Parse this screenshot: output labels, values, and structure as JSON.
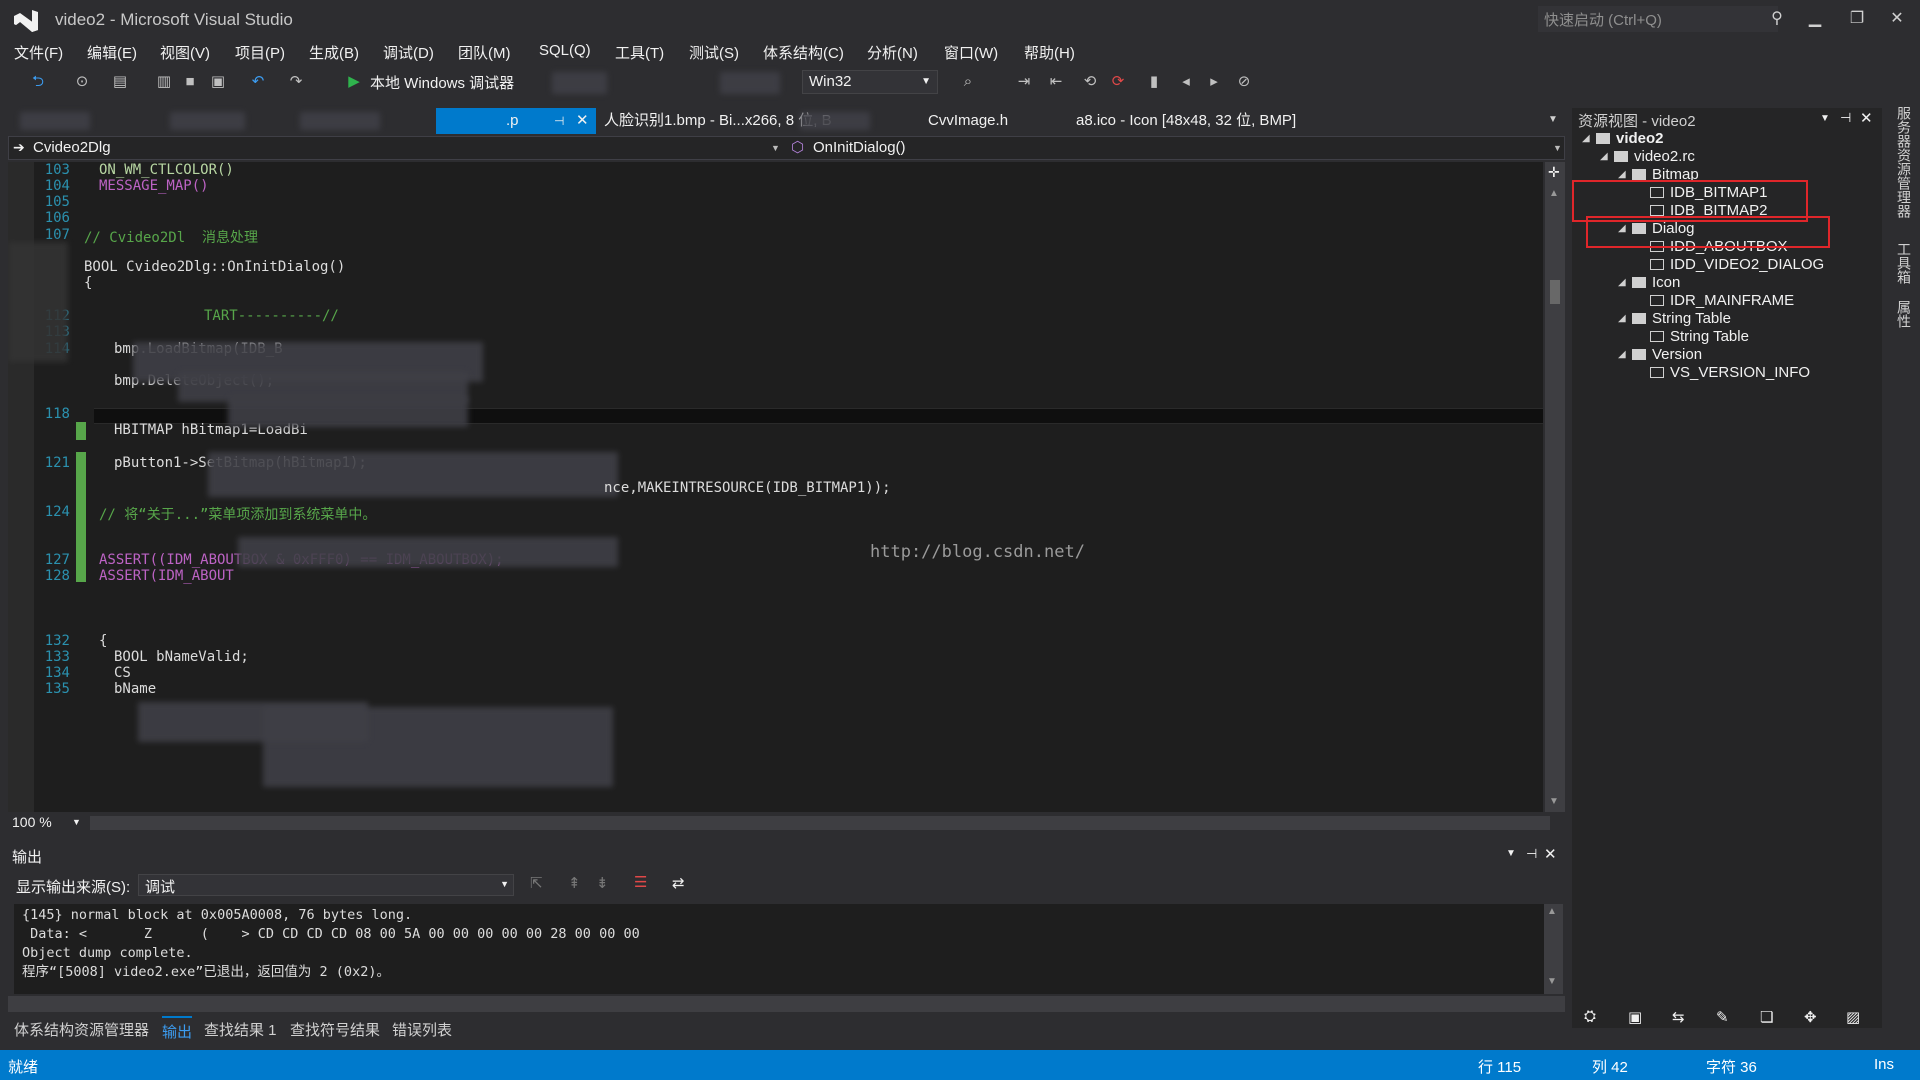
{
  "window": {
    "title": "video2 - Microsoft Visual Studio",
    "quick_launch": "快速启动 (Ctrl+Q)"
  },
  "menu": [
    "文件(F)",
    "编辑(E)",
    "视图(V)",
    "项目(P)",
    "生成(B)",
    "调试(D)",
    "团队(M)",
    "SQL(Q)",
    "工具(T)",
    "测试(S)",
    "体系结构(C)",
    "分析(N)",
    "窗口(W)",
    "帮助(H)"
  ],
  "toolbar": {
    "debug_target": "本地 Windows 调试器",
    "platform": "Win32"
  },
  "tabs": [
    {
      "label": ".p"
    },
    {
      "label": "人脸识别1.bmp - Bi...x266, 8 位, B"
    },
    {
      "label": "CvvImage.h"
    },
    {
      "label": "a8.ico - Icon [48x48, 32 位, BMP]"
    }
  ],
  "nav": {
    "class": "Cvideo2Dlg",
    "method": "OnInitDialog()"
  },
  "code": [
    {
      "ln": "103",
      "text": "ON_WM_CTLCOLOR()",
      "indent": 1,
      "color": "#b8d7a3"
    },
    {
      "ln": "104",
      "text": "MESSAGE_MAP()",
      "indent": 1,
      "color": "#bd63c5"
    },
    {
      "ln": "105",
      "text": "",
      "indent": 0,
      "color": "#dcdcdc"
    },
    {
      "ln": "106",
      "text": "",
      "indent": 0,
      "color": "#dcdcdc"
    },
    {
      "ln": "107",
      "text": "// Cvideo2Dl  消息处理",
      "indent": 0,
      "color": "#57a64a"
    },
    {
      "ln": "",
      "text": "BOOL Cvideo2Dlg::OnInitDialog()",
      "indent": 0,
      "color": "#dcdcdc"
    },
    {
      "ln": "",
      "text": "{",
      "indent": 0,
      "color": "#dcdcdc"
    },
    {
      "ln": "112",
      "text": "TART----------//",
      "indent": 8,
      "color": "#57a64a"
    },
    {
      "ln": "113",
      "text": "",
      "indent": 0,
      "color": "#dcdcdc"
    },
    {
      "ln": "114",
      "text": "bmp.LoadBitmap(IDB_B",
      "indent": 2,
      "color": "#dcdcdc"
    },
    {
      "ln": "",
      "text": "bmp.DeleteObject();",
      "indent": 2,
      "color": "#dcdcdc"
    },
    {
      "ln": "118",
      "text": "",
      "indent": 0,
      "color": "#dcdcdc"
    },
    {
      "ln": "",
      "text": "HBITMAP hBitmap1=LoadBi",
      "indent": 2,
      "color": "#dcdcdc"
    },
    {
      "ln": "121",
      "text": "pButton1->SetBitmap(hBitmap1);",
      "indent": 2,
      "color": "#dcdcdc"
    },
    {
      "ln": "124",
      "text": "// 将“关于...”菜单项添加到系统菜单中。",
      "indent": 1,
      "color": "#57a64a"
    },
    {
      "ln": "127",
      "text": "ASSERT((IDM_ABOUTBOX & 0xFFF0) == IDM_ABOUTBOX);",
      "indent": 1,
      "color": "#bd63c5"
    },
    {
      "ln": "128",
      "text": "ASSERT(IDM_ABOUT",
      "indent": 1,
      "color": "#bd63c5"
    },
    {
      "ln": "132",
      "text": "{",
      "indent": 1,
      "color": "#dcdcdc"
    },
    {
      "ln": "133",
      "text": "BOOL bNameValid;",
      "indent": 2,
      "color": "#dcdcdc"
    },
    {
      "ln": "134",
      "text": "CS",
      "indent": 2,
      "color": "#dcdcdc"
    },
    {
      "ln": "135",
      "text": "bName",
      "indent": 2,
      "color": "#dcdcdc"
    }
  ],
  "code_extra": {
    "line_118_tail": "nce,MAKEINTRESOURCE(IDB_BITMAP1));",
    "watermark": "http://blog.csdn.net/"
  },
  "editor": {
    "zoom": "100 %"
  },
  "output": {
    "title": "输出",
    "source_label": "显示输出来源(S):",
    "source_value": "调试",
    "lines": [
      "{145} normal block at 0x005A0008, 76 bytes long.",
      " Data: <       Z      (    > CD CD CD CD 08 00 5A 00 00 00 00 00 28 00 00 00",
      "Object dump complete.",
      "程序“[5008] video2.exe”已退出，返回值为 2 (0x2)。"
    ]
  },
  "bottom_tabs": [
    "体系结构资源管理器",
    "输出",
    "查找结果 1",
    "查找符号结果",
    "错误列表"
  ],
  "resource_view": {
    "title": "资源视图 - video2",
    "tree": [
      {
        "label": "video2",
        "depth": 0,
        "bold": true
      },
      {
        "label": "video2.rc",
        "depth": 1
      },
      {
        "label": "Bitmap",
        "depth": 2
      },
      {
        "label": "IDB_BITMAP1",
        "depth": 3,
        "leaf": true
      },
      {
        "label": "IDB_BITMAP2",
        "depth": 3,
        "leaf": true
      },
      {
        "label": "Dialog",
        "depth": 2
      },
      {
        "label": "IDD_ABOUTBOX",
        "depth": 3,
        "leaf": true
      },
      {
        "label": "IDD_VIDEO2_DIALOG",
        "depth": 3,
        "leaf": true
      },
      {
        "label": "Icon",
        "depth": 2
      },
      {
        "label": "IDR_MAINFRAME",
        "depth": 3,
        "leaf": true
      },
      {
        "label": "String Table",
        "depth": 2
      },
      {
        "label": "String Table",
        "depth": 3,
        "leaf": true
      },
      {
        "label": "Version",
        "depth": 2
      },
      {
        "label": "VS_VERSION_INFO",
        "depth": 3,
        "leaf": true
      }
    ]
  },
  "side_strip": [
    "服务器资源管理器",
    "工具箱",
    "属性"
  ],
  "status": {
    "ready": "就绪",
    "line": "行 115",
    "col": "列 42",
    "char": "字符 36",
    "mode": "Ins"
  },
  "colors": {
    "status_bar": "#007acc",
    "highlight_box": "#e0262a",
    "active_tab": "#007acc"
  }
}
